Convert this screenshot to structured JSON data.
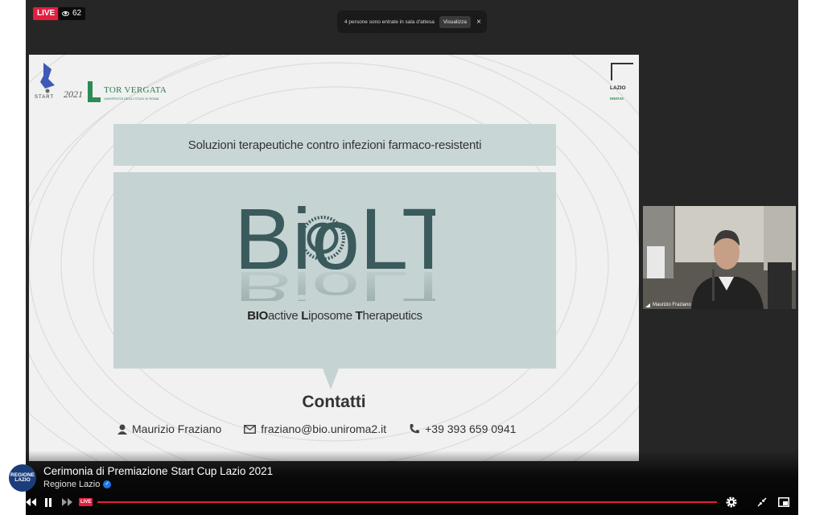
{
  "live": {
    "badge": "LIVE",
    "viewers": "62"
  },
  "toast": {
    "message": "4 persone sono entrate in sala d'attesa",
    "button": "Visualizza",
    "close": "×"
  },
  "slide": {
    "logos": {
      "start": "START",
      "start_year": "2021",
      "university": "TOR VERGATA",
      "university_sub": "UNIVERSITÀ DEGLI STUDI DI ROMA",
      "lazio": "LAZIO",
      "lazio_sub": "INNOVA"
    },
    "banner": "Soluzioni terapeutiche contro infezioni farmaco-resistenti",
    "brand": "BioLT",
    "tagline_parts": [
      "BIO",
      "active ",
      "L",
      "iposome ",
      "T",
      "herapeutics"
    ],
    "contacts_title": "Contatti",
    "contacts": {
      "name": "Maurizio Fraziano",
      "email": "fraziano@bio.uniroma2.it",
      "phone": "+39 393 659 0941"
    }
  },
  "webcam": {
    "participant": "Maurizio Fraziano"
  },
  "stream": {
    "title": "Cerimonia di Premiazione Start Cup Lazio 2021",
    "channel": "Regione Lazio",
    "avatar_text": "REGIONE LAZIO"
  },
  "player": {
    "live_label": "LIVE"
  },
  "colors": {
    "live_red": "#e41e3f",
    "verified_blue": "#1877f2",
    "panel": "#c6d3d3",
    "brand_teal": "#3a5a5c"
  }
}
